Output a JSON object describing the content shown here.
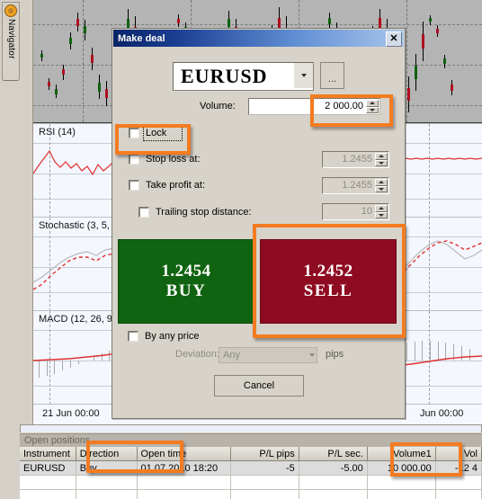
{
  "navigator": {
    "label": "Navigator",
    "icon": "navigator-sun-icon"
  },
  "chart": {
    "panes": [
      {
        "id": "price",
        "label": ""
      },
      {
        "id": "rsi",
        "label": "RSI (14)"
      },
      {
        "id": "stochastic",
        "label": "Stochastic (3, 5,"
      },
      {
        "id": "macd",
        "label": "MACD (12, 26, 9"
      }
    ],
    "time_axis": {
      "left_label": "21 Jun 00:00",
      "right_label": "Jun 00:00"
    }
  },
  "dialog": {
    "title": "Make deal",
    "close_label": "✕",
    "symbol": {
      "value": "EURUSD",
      "browse_label": "..."
    },
    "volume": {
      "label": "Volume:",
      "value": "2 000.00"
    },
    "options": [
      {
        "id": "lock",
        "label": "Lock",
        "checked": false,
        "focused": true,
        "value": null
      },
      {
        "id": "stop_loss",
        "label": "Stop loss at:",
        "checked": false,
        "value": "1.2455"
      },
      {
        "id": "take_profit",
        "label": "Take profit at:",
        "checked": false,
        "value": "1.2455"
      },
      {
        "id": "trailing_stop",
        "label": "Trailing stop distance:",
        "checked": false,
        "value": "10"
      }
    ],
    "buy": {
      "price": "1.2454",
      "action": "BUY",
      "color": "#106310"
    },
    "sell": {
      "price": "1.2452",
      "action": "SELL",
      "color": "#8f0b21"
    },
    "by_any_price": {
      "label": "By any price",
      "checked": false
    },
    "deviation": {
      "label": "Deviation:",
      "value": "Any",
      "unit": "pips"
    },
    "cancel_label": "Cancel"
  },
  "annotations": [
    {
      "id": "volume-field-highlight",
      "color": "#f47b20"
    },
    {
      "id": "lock-checkbox-highlight",
      "color": "#f47b20"
    },
    {
      "id": "sell-button-highlight",
      "color": "#f47b20"
    },
    {
      "id": "direction-column-highlight",
      "color": "#f47b20"
    },
    {
      "id": "volume1-column-highlight",
      "color": "#f47b20"
    }
  ],
  "open_positions": {
    "panel_title": "Open positions",
    "columns": [
      "Instrument",
      "Direction",
      "Open time",
      "P/L pips",
      "P/L sec.",
      "Volume1",
      "Vol"
    ],
    "rows": [
      {
        "Instrument": "EURUSD",
        "Direction": "Buy",
        "Open time": "01.07.2010 18:20",
        "P/L pips": "-5",
        "P/L sec.": "-5.00",
        "Volume1": "10 000.00",
        "Vol": "-12 4"
      }
    ]
  }
}
